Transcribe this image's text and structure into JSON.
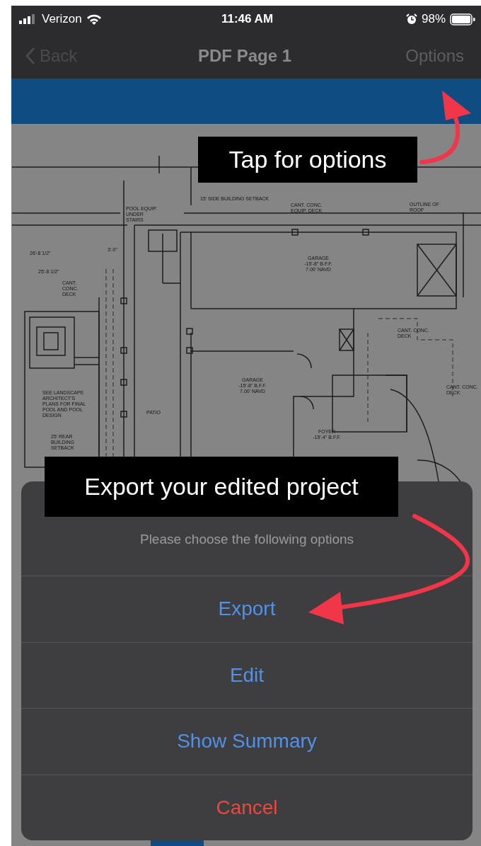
{
  "status_bar": {
    "carrier": "Verizon",
    "time": "11:46 AM",
    "battery": "98%"
  },
  "nav_bar": {
    "back": "Back",
    "title": "PDF Page 1",
    "options": "Options"
  },
  "plan_labels": [
    {
      "lines": [
        "15' SIDE BUILDING SETBACK"
      ]
    },
    {
      "lines": [
        "POOL EQUIP.",
        "UNDER",
        "STAIRS"
      ]
    },
    {
      "lines": [
        "CANT. CONC.",
        "EQUIP. DECK"
      ]
    },
    {
      "lines": [
        "OUTLINE OF",
        "ROOF"
      ]
    },
    {
      "lines": [
        "26'-8 1/2\""
      ]
    },
    {
      "lines": [
        "25'-8 1/2\""
      ]
    },
    {
      "lines": [
        "3'-0\""
      ]
    },
    {
      "lines": [
        "GARAGE",
        "-15'-8\" B.F.F.",
        "7.00' NAVD"
      ]
    },
    {
      "lines": [
        "CANT.",
        "CONC.",
        "DECK"
      ]
    },
    {
      "lines": [
        "CANT. CONC.",
        "DECK"
      ]
    },
    {
      "lines": [
        "GARAGE",
        "-15'-8\" B.F.F.",
        "7.00' NAVD"
      ]
    },
    {
      "lines": [
        "CANT. CONC.",
        "DECK"
      ]
    },
    {
      "lines": [
        "SEE LANDSCAPE",
        "ARCHITECT'S",
        "PLANS FOR FINAL",
        "POOL AND POOL",
        "DESIGN"
      ]
    },
    {
      "lines": [
        "PATIO"
      ]
    },
    {
      "lines": [
        "25' REAR",
        "BUILDING",
        "SETBACK"
      ]
    },
    {
      "lines": [
        "FOYER",
        "-15'-4\" B.F.F."
      ]
    }
  ],
  "callouts": [
    {
      "text": "Tap for options"
    },
    {
      "text": "Export your edited project"
    }
  ],
  "action_sheet": {
    "message": "Please choose the following options",
    "actions": [
      {
        "label": "Export",
        "kind": "default"
      },
      {
        "label": "Edit",
        "kind": "default"
      },
      {
        "label": "Show Summary",
        "kind": "default"
      },
      {
        "label": "Cancel",
        "kind": "destructive"
      }
    ]
  }
}
